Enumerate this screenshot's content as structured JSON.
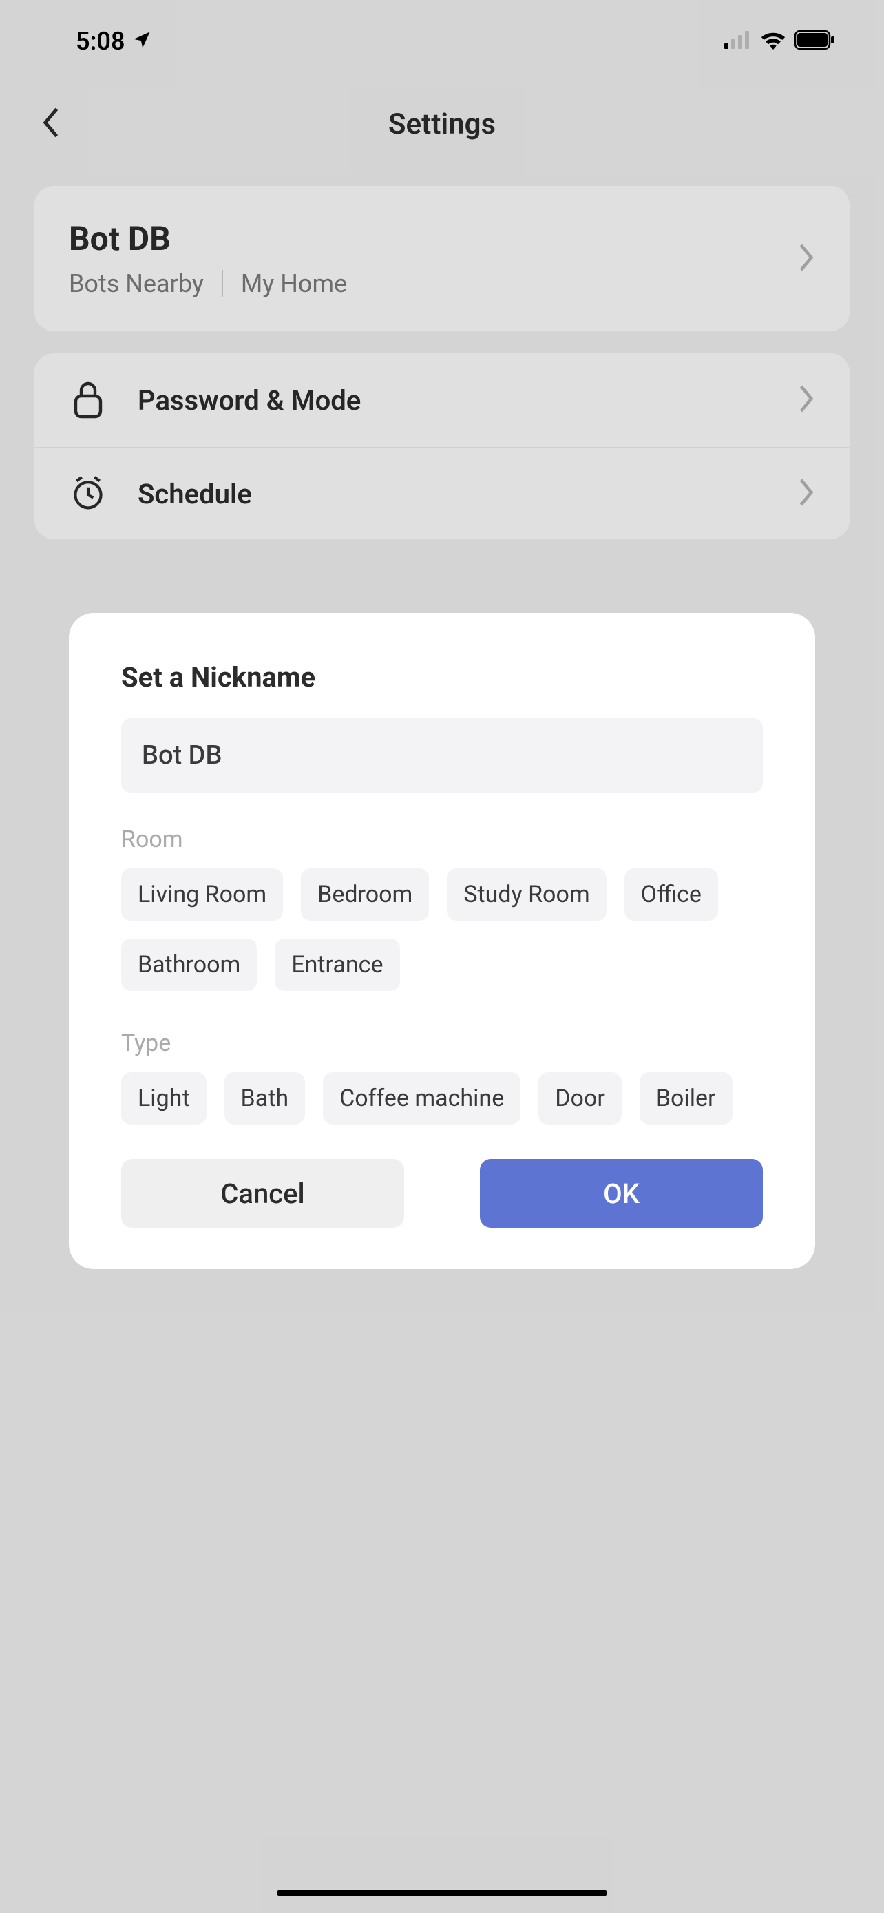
{
  "status": {
    "time": "5:08"
  },
  "nav": {
    "title": "Settings"
  },
  "device": {
    "name": "Bot DB",
    "sub1": "Bots Nearby",
    "sub2": "My Home"
  },
  "settings": {
    "password_mode": "Password & Mode",
    "schedule": "Schedule"
  },
  "modal": {
    "title": "Set a Nickname",
    "value": "Bot DB",
    "room_label": "Room",
    "rooms": [
      "Living Room",
      "Bedroom",
      "Study Room",
      "Office",
      "Bathroom",
      "Entrance"
    ],
    "type_label": "Type",
    "types": [
      "Light",
      "Bath",
      "Coffee machine",
      "Door",
      "Boiler"
    ],
    "cancel": "Cancel",
    "ok": "OK"
  }
}
